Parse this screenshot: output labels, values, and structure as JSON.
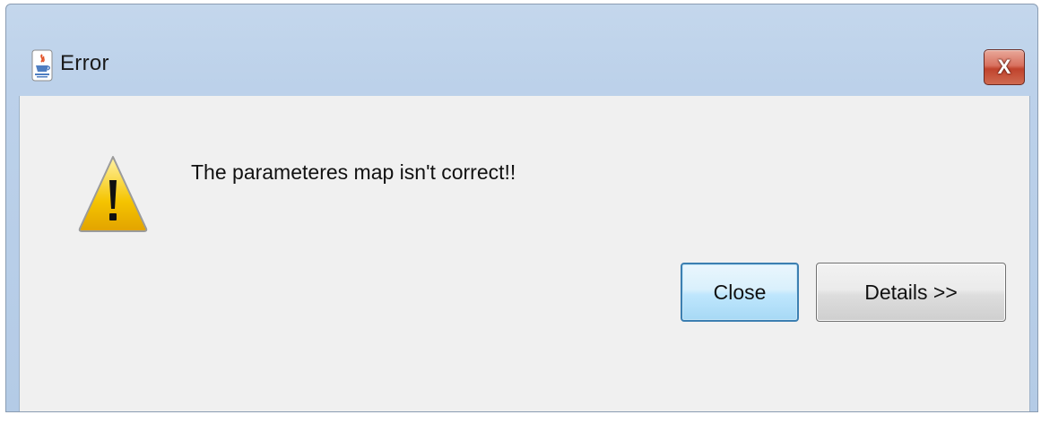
{
  "window": {
    "title": "Error",
    "app_icon": "java-cup-icon",
    "close_button_glyph": "X"
  },
  "dialog": {
    "icon": "warning-icon",
    "message": "The parameteres map isn't correct!!",
    "buttons": {
      "close_label": "Close",
      "details_label": "Details >>"
    }
  },
  "colors": {
    "titlebar": "#bcd1ea",
    "client_background": "#f0f0f0",
    "close_button_red": "#c0432d",
    "default_button_border": "#3c7fb1",
    "warning_yellow": "#f2c200"
  }
}
